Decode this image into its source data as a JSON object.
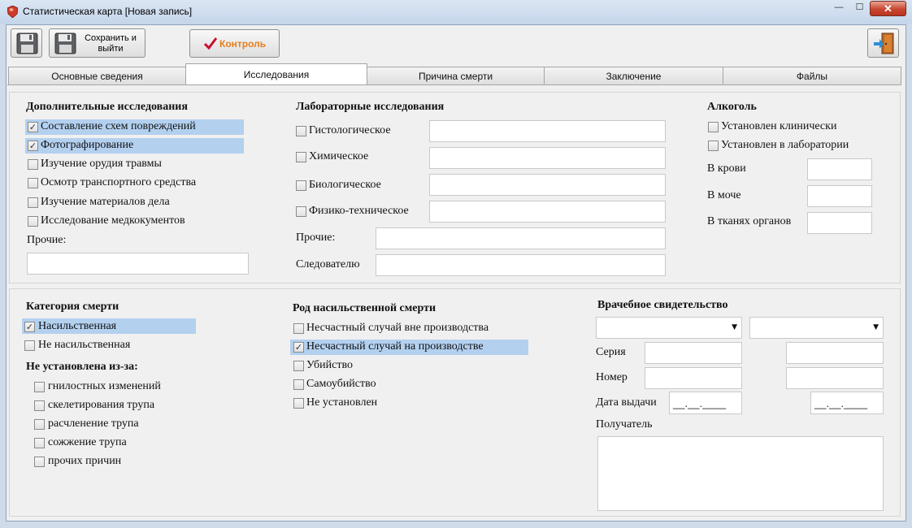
{
  "window": {
    "title": "Статистическая карта [Новая запись]",
    "close_glyph": "✕",
    "min_glyph": "—",
    "max_glyph": "☐"
  },
  "toolbar": {
    "save_icon": "floppy-disk-icon",
    "save_exit_label": "Сохранить и выйти",
    "control_label": "Контроль",
    "control_icon": "checkmark-icon",
    "exit_icon": "exit-door-icon"
  },
  "tabs": [
    {
      "label": "Основные сведения",
      "active": false
    },
    {
      "label": "Исследования",
      "active": true
    },
    {
      "label": "Причина смерти",
      "active": false
    },
    {
      "label": "Заключение",
      "active": false
    },
    {
      "label": "Файлы",
      "active": false
    }
  ],
  "additional": {
    "heading": "Дополнительные исследования",
    "items": [
      {
        "label": "Составление схем повреждений",
        "checked": true
      },
      {
        "label": "Фотографирование",
        "checked": true
      },
      {
        "label": "Изучение орудия травмы",
        "checked": false
      },
      {
        "label": "Осмотр транспортного средства",
        "checked": false
      },
      {
        "label": "Изучение материалов дела",
        "checked": false
      },
      {
        "label": "Исследование медкокументов",
        "checked": false
      }
    ],
    "other_label": "Прочие:",
    "other_value": ""
  },
  "lab": {
    "heading": "Лабораторные исследования",
    "items": [
      {
        "label": "Гистологическое",
        "checked": false,
        "value": ""
      },
      {
        "label": "Химическое",
        "checked": false,
        "value": ""
      },
      {
        "label": "Биологическое",
        "checked": false,
        "value": ""
      },
      {
        "label": "Физико-техническое",
        "checked": false,
        "value": ""
      }
    ],
    "other_label": "Прочие:",
    "investigator_label": "Следователю"
  },
  "alcohol": {
    "heading": "Алкоголь",
    "clinical": {
      "label": "Установлен клинически",
      "checked": false
    },
    "laboratory": {
      "label": "Установлен в лаборатории",
      "checked": false
    },
    "blood_label": "В крови",
    "urine_label": "В моче",
    "tissue_label": "В тканях органов"
  },
  "death_category": {
    "heading": "Категория смерти",
    "violent": {
      "label": "Насильственная",
      "checked": true
    },
    "nonviolent": {
      "label": "Не насильственная",
      "checked": false
    },
    "undetermined_heading": "Не установлена из-за:",
    "reasons": [
      {
        "label": "гнилостных изменений",
        "checked": false
      },
      {
        "label": "скелетирования трупа",
        "checked": false
      },
      {
        "label": "расчленение трупа",
        "checked": false
      },
      {
        "label": "сожжение трупа",
        "checked": false
      },
      {
        "label": "прочих причин",
        "checked": false
      }
    ]
  },
  "violent_kind": {
    "heading": "Род насильственной смерти",
    "items": [
      {
        "label": "Несчастный случай вне производства",
        "checked": false
      },
      {
        "label": "Несчастный случай на производстве",
        "checked": true
      },
      {
        "label": "Убийство",
        "checked": false
      },
      {
        "label": "Самоубийство",
        "checked": false
      },
      {
        "label": "Не установлен",
        "checked": false
      }
    ]
  },
  "certificate": {
    "heading": "Врачебное свидетельство",
    "series_label": "Серия",
    "number_label": "Номер",
    "issue_date_label": "Дата выдачи",
    "date_mask": "__.__.____",
    "recipient_label": "Получатель"
  },
  "colors": {
    "highlight": "#b3d0ef",
    "control_text": "#e67e1c",
    "close_button": "#c8462f"
  }
}
